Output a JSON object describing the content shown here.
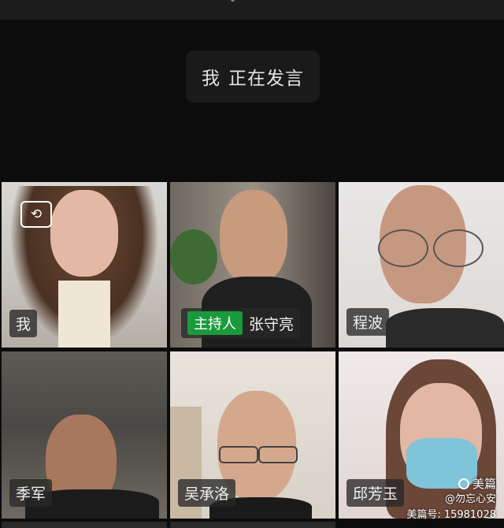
{
  "speaking": {
    "self_label": "我",
    "status": "正在发言"
  },
  "colors": {
    "active_border": "#1f9d3a",
    "host_badge": "#1a9a3c",
    "background": "#0c0c0c"
  },
  "icons": {
    "switch_camera": "camera-switch-icon",
    "brand_logo": "meipian-logo-icon"
  },
  "participants": [
    {
      "name": "我",
      "active": true,
      "host": false,
      "has_switch_camera": true
    },
    {
      "name": "张守亮",
      "active": false,
      "host": true,
      "host_label": "主持人"
    },
    {
      "name": "程波",
      "active": false,
      "host": false
    },
    {
      "name": "季军",
      "active": false,
      "host": false
    },
    {
      "name": "吴承洛",
      "active": false,
      "host": false
    },
    {
      "name": "邱芳玉",
      "active": false,
      "host": false
    }
  ],
  "watermark": {
    "brand": "美篇",
    "handle": "@勿忘心安",
    "id_line": "美篇号: 15981028"
  }
}
